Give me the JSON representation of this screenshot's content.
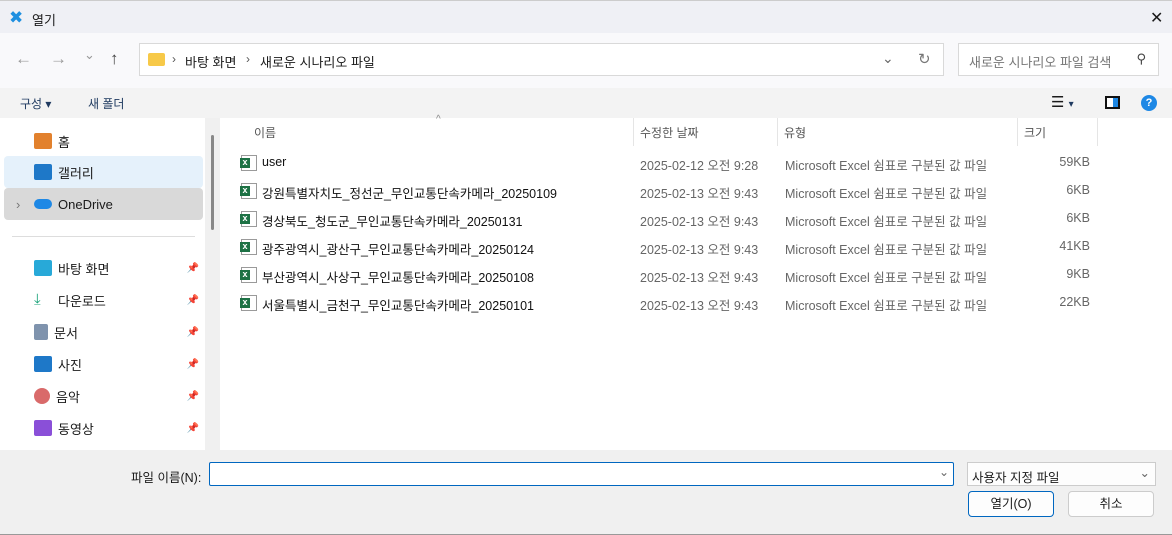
{
  "window": {
    "title": "열기",
    "close": "✕"
  },
  "nav": {
    "back": "←",
    "forward": "→",
    "recent": "⌄",
    "up": "↑",
    "breadcrumb": [
      "바탕 화면",
      "새로운 시나리오 파일"
    ],
    "search_placeholder": "새로운 시나리오 파일 검색"
  },
  "toolbar": {
    "organize": "구성",
    "new_folder": "새 폴더"
  },
  "sidebar": {
    "top": [
      {
        "label": "홈"
      },
      {
        "label": "갤러리"
      },
      {
        "label": "OneDrive"
      }
    ],
    "pinned": [
      {
        "label": "바탕 화면"
      },
      {
        "label": "다운로드"
      },
      {
        "label": "문서"
      },
      {
        "label": "사진"
      },
      {
        "label": "음악"
      },
      {
        "label": "동영상"
      }
    ]
  },
  "columns": {
    "name": "이름",
    "date": "수정한 날짜",
    "type": "유형",
    "size": "크기"
  },
  "files": [
    {
      "name": "user",
      "date": "2025-02-12 오전 9:28",
      "type": "Microsoft Excel 쉼표로 구분된 값 파일",
      "size": "59KB"
    },
    {
      "name": "강원특별자치도_정선군_무인교통단속카메라_20250109",
      "date": "2025-02-13 오전 9:43",
      "type": "Microsoft Excel 쉼표로 구분된 값 파일",
      "size": "6KB"
    },
    {
      "name": "경상북도_청도군_무인교통단속카메라_20250131",
      "date": "2025-02-13 오전 9:43",
      "type": "Microsoft Excel 쉼표로 구분된 값 파일",
      "size": "6KB"
    },
    {
      "name": "광주광역시_광산구_무인교통단속카메라_20250124",
      "date": "2025-02-13 오전 9:43",
      "type": "Microsoft Excel 쉼표로 구분된 값 파일",
      "size": "41KB"
    },
    {
      "name": "부산광역시_사상구_무인교통단속카메라_20250108",
      "date": "2025-02-13 오전 9:43",
      "type": "Microsoft Excel 쉼표로 구분된 값 파일",
      "size": "9KB"
    },
    {
      "name": "서울특별시_금천구_무인교통단속카메라_20250101",
      "date": "2025-02-13 오전 9:43",
      "type": "Microsoft Excel 쉼표로 구분된 값 파일",
      "size": "22KB"
    }
  ],
  "bottom": {
    "filename_label": "파일 이름(N):",
    "filename_value": "",
    "filetype": "사용자 지정 파일",
    "open": "열기(O)",
    "cancel": "취소"
  }
}
